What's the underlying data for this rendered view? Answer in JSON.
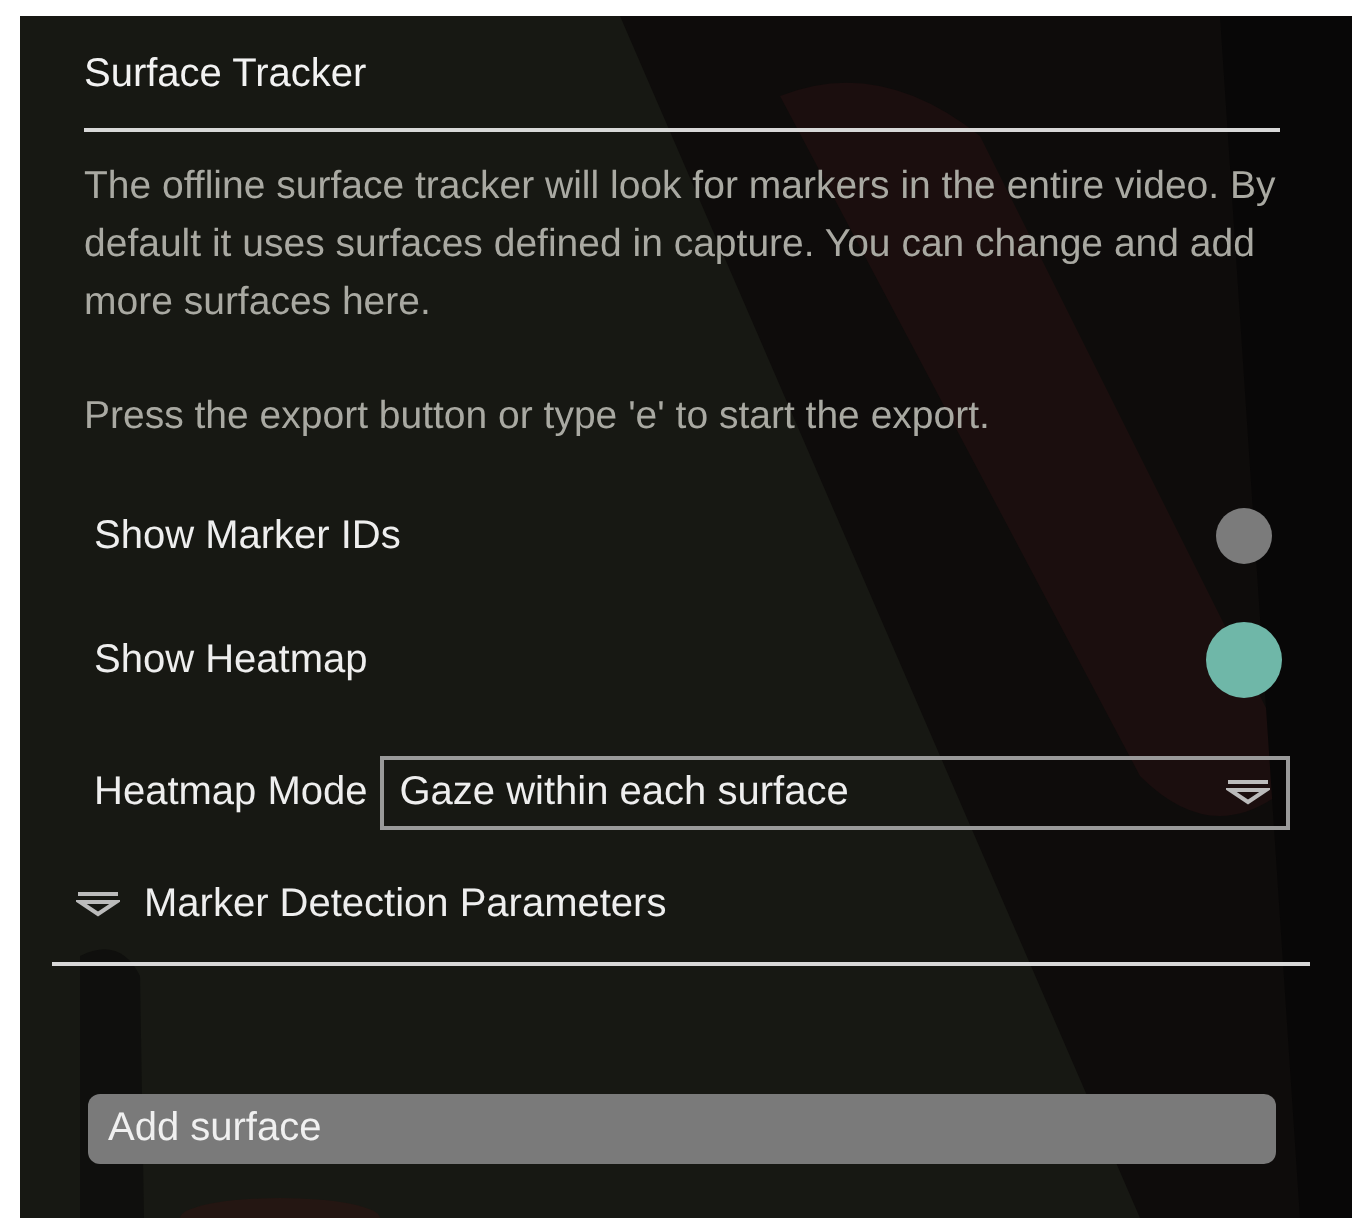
{
  "title": "Surface Tracker",
  "paragraphs": [
    "The offline surface tracker will look for markers in the entire video. By default it uses surfaces defined in capture. You can change and add more surfaces here.",
    "Press the export button or type 'e' to start the export."
  ],
  "toggles": [
    {
      "label": "Show Marker IDs",
      "on": false
    },
    {
      "label": "Show Heatmap",
      "on": true
    }
  ],
  "heatmap_mode": {
    "label": "Heatmap Mode",
    "value": "Gaze within each surface"
  },
  "submenu": {
    "label": "Marker Detection Parameters"
  },
  "buttons": [
    "Add surface"
  ],
  "background": {
    "kind": "picture"
  }
}
